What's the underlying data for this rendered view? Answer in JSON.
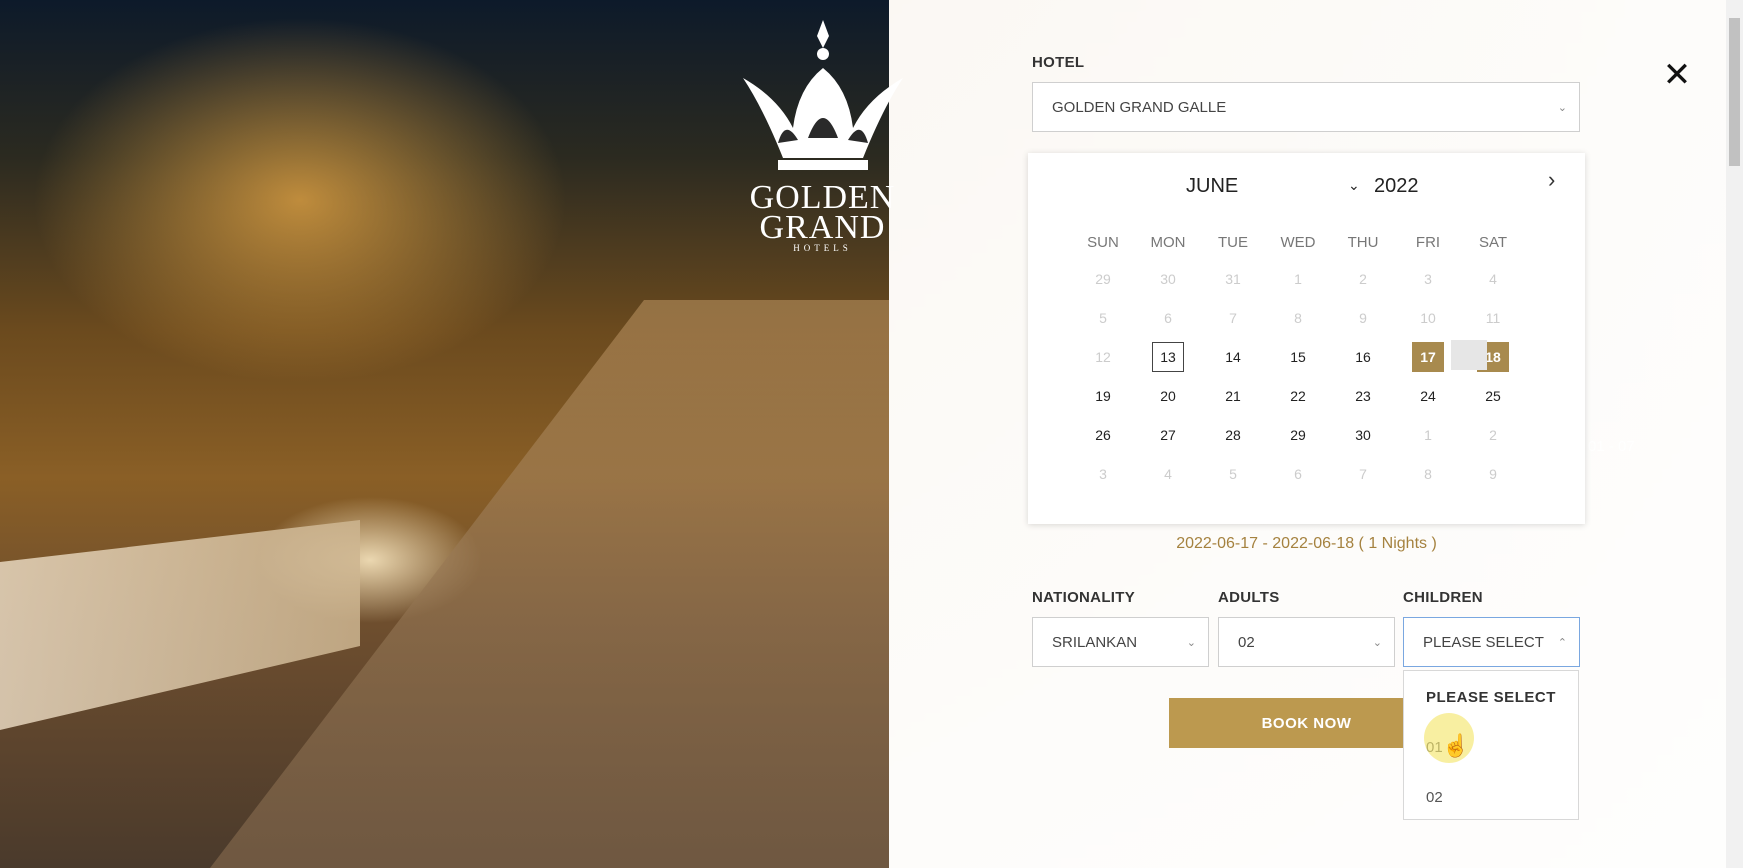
{
  "hotel": {
    "label": "HOTEL",
    "value": "GOLDEN GRAND GALLE"
  },
  "calendar": {
    "month": "JUNE",
    "year": "2022",
    "weekdays": [
      "SUN",
      "MON",
      "TUE",
      "WED",
      "THU",
      "FRI",
      "SAT"
    ],
    "weeks": [
      [
        {
          "d": "29",
          "m": true
        },
        {
          "d": "30",
          "m": true
        },
        {
          "d": "31",
          "m": true
        },
        {
          "d": "1",
          "m": true
        },
        {
          "d": "2",
          "m": true
        },
        {
          "d": "3",
          "m": true
        },
        {
          "d": "4",
          "m": true
        }
      ],
      [
        {
          "d": "5",
          "m": true
        },
        {
          "d": "6",
          "m": true
        },
        {
          "d": "7",
          "m": true
        },
        {
          "d": "8",
          "m": true
        },
        {
          "d": "9",
          "m": true
        },
        {
          "d": "10",
          "m": true
        },
        {
          "d": "11",
          "m": true
        }
      ],
      [
        {
          "d": "12",
          "m": true
        },
        {
          "d": "13",
          "today": true
        },
        {
          "d": "14"
        },
        {
          "d": "15"
        },
        {
          "d": "16"
        },
        {
          "d": "17",
          "sel": true
        },
        {
          "d": "18",
          "sel": true
        }
      ],
      [
        {
          "d": "19"
        },
        {
          "d": "20"
        },
        {
          "d": "21"
        },
        {
          "d": "22"
        },
        {
          "d": "23"
        },
        {
          "d": "24"
        },
        {
          "d": "25"
        }
      ],
      [
        {
          "d": "26"
        },
        {
          "d": "27"
        },
        {
          "d": "28"
        },
        {
          "d": "29"
        },
        {
          "d": "30"
        },
        {
          "d": "1",
          "m": true
        },
        {
          "d": "2",
          "m": true
        }
      ],
      [
        {
          "d": "3",
          "m": true
        },
        {
          "d": "4",
          "m": true
        },
        {
          "d": "5",
          "m": true
        },
        {
          "d": "6",
          "m": true
        },
        {
          "d": "7",
          "m": true
        },
        {
          "d": "8",
          "m": true
        },
        {
          "d": "9",
          "m": true
        }
      ]
    ]
  },
  "summary": "2022-06-17 - 2022-06-18 ( 1 Nights )",
  "nationality": {
    "label": "NATIONALITY",
    "value": "SRILANKAN"
  },
  "adults": {
    "label": "ADULTS",
    "value": "02"
  },
  "children": {
    "label": "CHILDREN",
    "value": "PLEASE SELECT",
    "options": [
      "PLEASE SELECT",
      "01",
      "02"
    ]
  },
  "book_label": "BOOK NOW",
  "logo": {
    "name_line1": "GOLDEN",
    "name_line2": "GRAND",
    "sub": "HOTELS"
  },
  "bg_hint": "01 - 07",
  "colors": {
    "accent": "#bc994f",
    "selected_day": "#a88a4e",
    "summary_text": "#a5823f"
  }
}
